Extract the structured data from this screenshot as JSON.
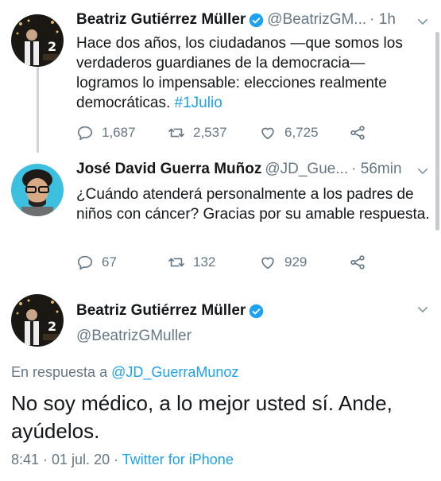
{
  "tweets": [
    {
      "name": "Beatriz Gutiérrez Müller",
      "handle": "@BeatrizGM...",
      "time": "· 1h",
      "text_main": "Hace dos años, los ciudadanos —que somos los verdaderos guardianes de la democracia— logramos lo impensable: elecciones realmente democráticas. ",
      "hashtag": "#1Julio",
      "replies": "1,687",
      "retweets": "2,537",
      "likes": "6,725"
    },
    {
      "name": "José David Guerra Muñoz",
      "handle": "@JD_Gue...",
      "time": "· 56min",
      "text": "¿Cuándo atenderá personalmente a los padres de niños con cáncer? Gracias por su amable respuesta.",
      "replies": "67",
      "retweets": "132",
      "likes": "929"
    }
  ],
  "main_tweet": {
    "name": "Beatriz Gutiérrez Müller",
    "handle": "@BeatrizGMuller",
    "reply_prefix": "En respuesta a ",
    "reply_mention": "@JD_GuerraMunoz",
    "text": "No soy médico, a lo mejor usted sí. Ande, ayúdelos.",
    "timestamp": "8:41 · 01 jul. 20 · ",
    "client": "Twitter for iPhone"
  },
  "icons": {
    "verified": "verified-badge-icon",
    "reply": "reply-icon",
    "retweet": "retweet-icon",
    "like": "heart-icon",
    "share": "share-icon",
    "menu": "chevron-down-icon"
  },
  "colors": {
    "accent": "#1da1f2",
    "secondary_text": "#657786",
    "thread_line": "#ccd6dd"
  }
}
